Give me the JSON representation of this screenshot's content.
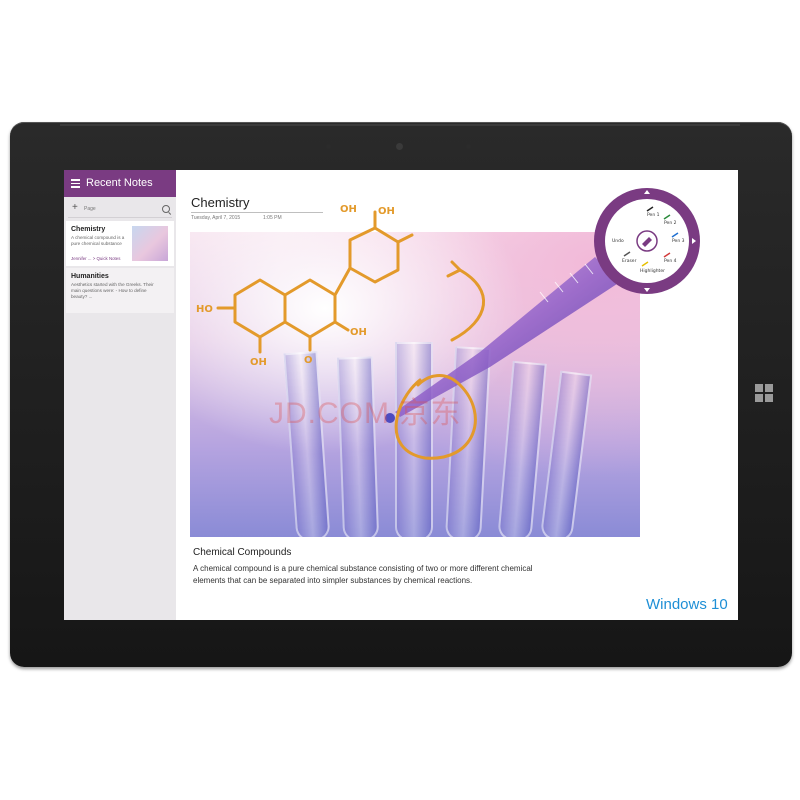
{
  "sidebar": {
    "title": "Recent Notes",
    "add_label": "Page",
    "notes": [
      {
        "title": "Chemistry",
        "preview": "A chemical compound is a pure chemical substance",
        "tag": "Jennifer ... > Quick Notes"
      },
      {
        "title": "Humanities",
        "preview": "Aesthetics started with the Greeks. Their main questions were: - How to define beauty? ..."
      }
    ]
  },
  "page": {
    "title": "Chemistry",
    "date": "Tuesday, April 7, 2015",
    "time": "1:05 PM"
  },
  "content": {
    "heading": "Chemical Compounds",
    "body": "A chemical compound is a pure chemical substance consisting of two or more different chemical elements that can be separated into simpler substances by chemical reactions."
  },
  "annotations": {
    "labels": [
      "OH",
      "OH",
      "HO",
      "OH",
      "OH",
      "O"
    ]
  },
  "pen_menu": {
    "items": [
      "Pen 1",
      "Pen 2",
      "Pen 3",
      "Pen 4",
      "Highlighter",
      "Eraser",
      "Undo"
    ]
  },
  "branding": {
    "os": "Windows 10",
    "watermark": "JD.COM 京东"
  },
  "colors": {
    "accent": "#7a3b82",
    "ink": "#e39a2b",
    "windows_blue": "#1e8fd6"
  }
}
